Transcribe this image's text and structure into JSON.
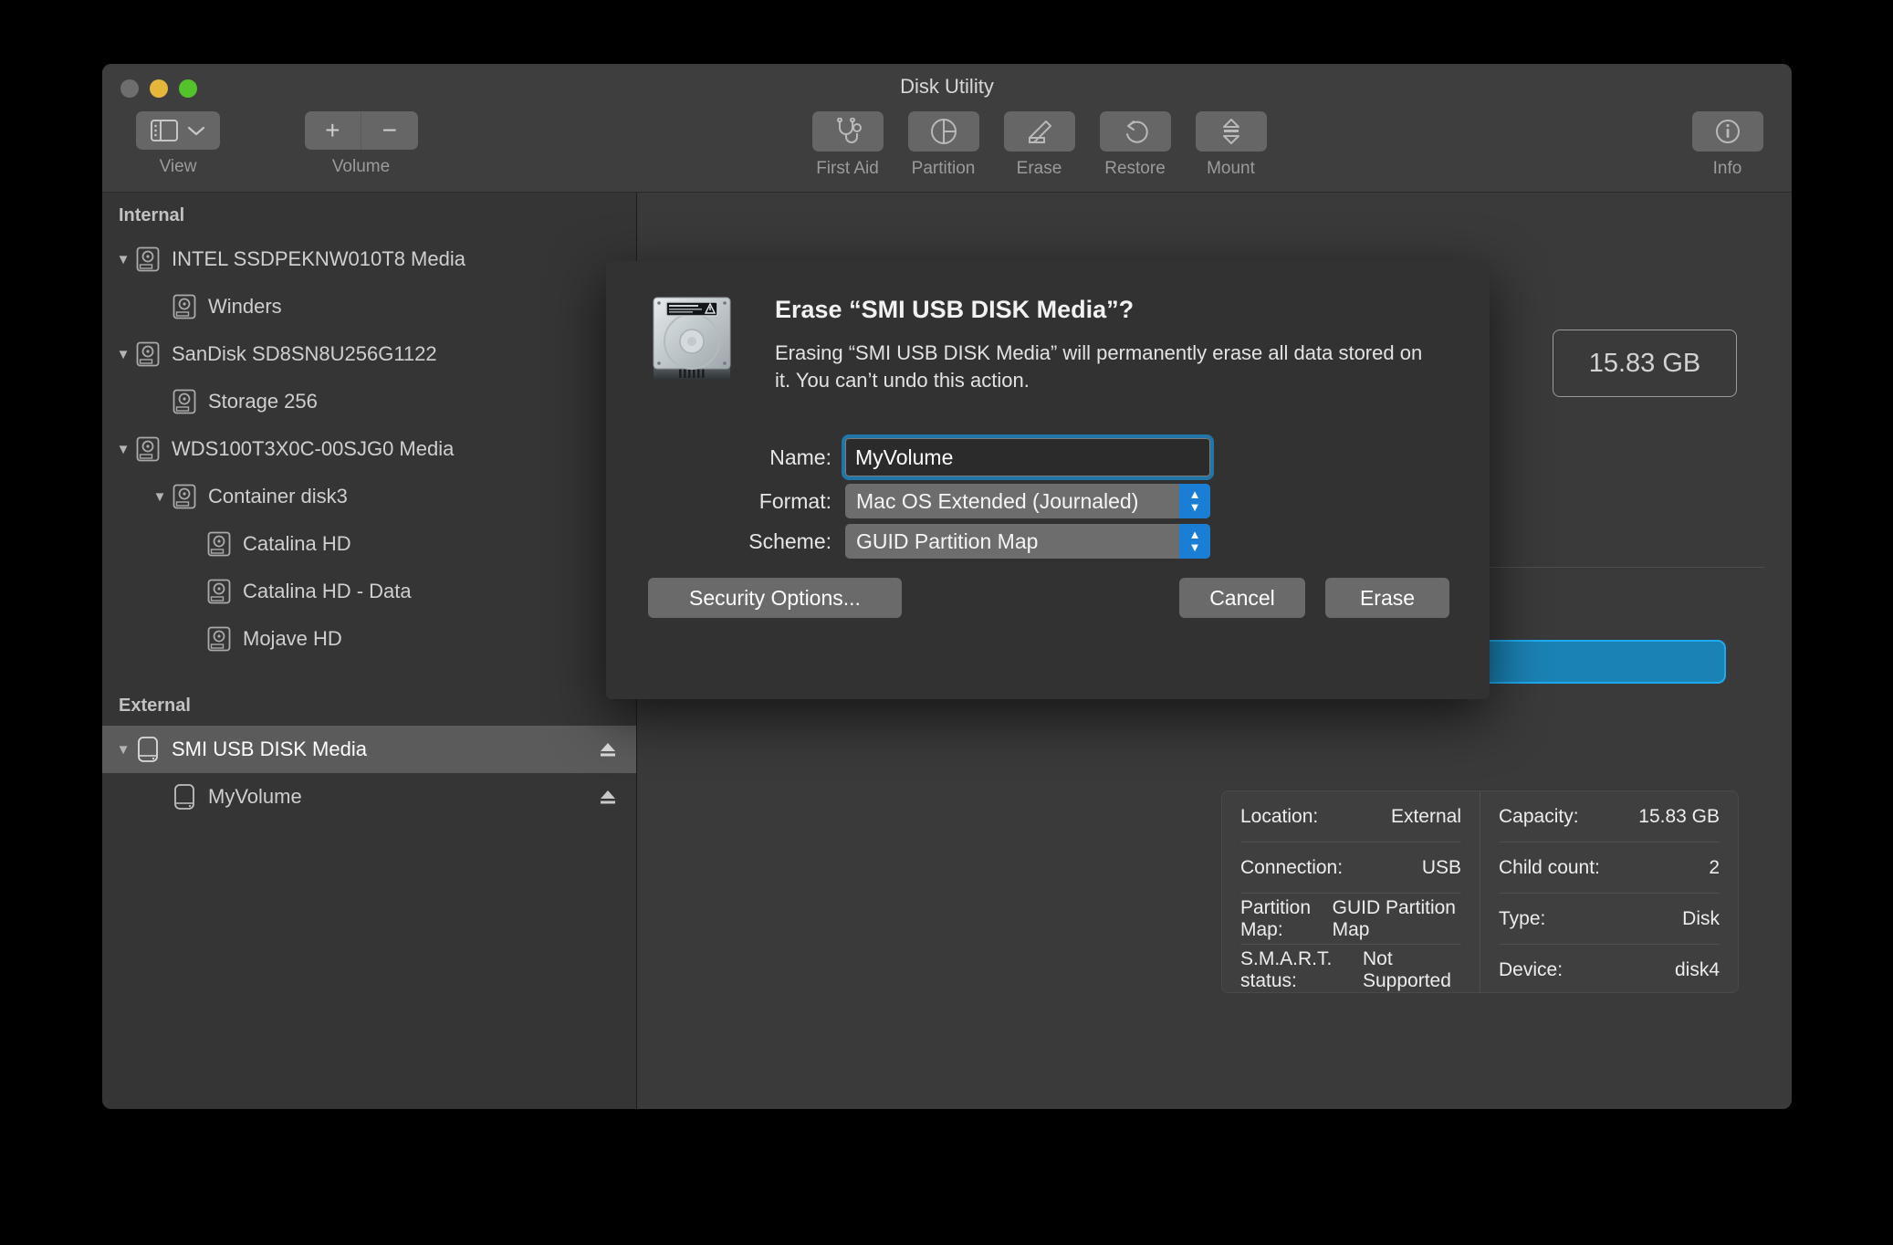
{
  "window": {
    "title": "Disk Utility",
    "traffic_lights": [
      "close",
      "minimize",
      "zoom"
    ]
  },
  "toolbar": {
    "view_label": "View",
    "volume_label": "Volume",
    "volume_add": "+",
    "volume_remove": "−",
    "items": [
      {
        "label": "First Aid",
        "icon": "stethoscope-icon"
      },
      {
        "label": "Partition",
        "icon": "pie-chart-icon"
      },
      {
        "label": "Erase",
        "icon": "erase-pencil-icon"
      },
      {
        "label": "Restore",
        "icon": "undo-arrow-icon"
      },
      {
        "label": "Mount",
        "icon": "mount-eject-icon"
      }
    ],
    "info_label": "Info"
  },
  "sidebar": {
    "sections": [
      {
        "header": "Internal",
        "items": [
          {
            "label": "INTEL SSDPEKNW010T8 Media",
            "indent": 0,
            "disclosure": "▼",
            "icon": "internal-disk-icon",
            "eject": false,
            "selected": false
          },
          {
            "label": "Winders",
            "indent": 1,
            "disclosure": "",
            "icon": "internal-disk-icon",
            "eject": false,
            "selected": false
          },
          {
            "label": "SanDisk SD8SN8U256G1122",
            "indent": 0,
            "disclosure": "▼",
            "icon": "internal-disk-icon",
            "eject": false,
            "selected": false
          },
          {
            "label": "Storage 256",
            "indent": 1,
            "disclosure": "",
            "icon": "internal-disk-icon",
            "eject": false,
            "selected": false
          },
          {
            "label": "WDS100T3X0C-00SJG0 Media",
            "indent": 0,
            "disclosure": "▼",
            "icon": "internal-disk-icon",
            "eject": false,
            "selected": false
          },
          {
            "label": "Container disk3",
            "indent": 1,
            "disclosure": "▼",
            "icon": "internal-disk-icon",
            "eject": false,
            "selected": false
          },
          {
            "label": "Catalina HD",
            "indent": 2,
            "disclosure": "",
            "icon": "internal-disk-icon",
            "eject": false,
            "selected": false
          },
          {
            "label": "Catalina HD - Data",
            "indent": 2,
            "disclosure": "",
            "icon": "internal-disk-icon",
            "eject": false,
            "selected": false
          },
          {
            "label": "Mojave HD",
            "indent": 2,
            "disclosure": "",
            "icon": "internal-disk-icon",
            "eject": false,
            "selected": false
          }
        ]
      },
      {
        "header": "External",
        "items": [
          {
            "label": "SMI USB DISK Media",
            "indent": 0,
            "disclosure": "▼",
            "icon": "external-disk-icon",
            "eject": true,
            "selected": true
          },
          {
            "label": "MyVolume",
            "indent": 1,
            "disclosure": "",
            "icon": "external-disk-icon",
            "eject": true,
            "selected": false
          }
        ]
      }
    ]
  },
  "detail": {
    "capacity_badge": "15.83 GB",
    "info_left": [
      {
        "label": "Location:",
        "value": "External"
      },
      {
        "label": "Connection:",
        "value": "USB"
      },
      {
        "label": "Partition Map:",
        "value": "GUID Partition Map"
      },
      {
        "label": "S.M.A.R.T. status:",
        "value": "Not Supported"
      }
    ],
    "info_right": [
      {
        "label": "Capacity:",
        "value": "15.83 GB"
      },
      {
        "label": "Child count:",
        "value": "2"
      },
      {
        "label": "Type:",
        "value": "Disk"
      },
      {
        "label": "Device:",
        "value": "disk4"
      }
    ]
  },
  "sheet": {
    "title": "Erase “SMI USB DISK Media”?",
    "message": "Erasing “SMI USB DISK Media” will permanently erase all data stored on it. You can’t undo this action.",
    "name_label": "Name:",
    "name_value": "MyVolume",
    "format_label": "Format:",
    "format_value": "Mac OS Extended (Journaled)",
    "scheme_label": "Scheme:",
    "scheme_value": "GUID Partition Map",
    "security_button": "Security Options...",
    "cancel_button": "Cancel",
    "erase_button": "Erase"
  },
  "colors": {
    "accent_blue": "#1a7fd4",
    "usage_bar": "#1a82b4",
    "usage_bar_border": "#1eaaf0",
    "selection": "#5b5b5b",
    "window_bg": "#3a3a3a",
    "sheet_bg": "#323232"
  }
}
